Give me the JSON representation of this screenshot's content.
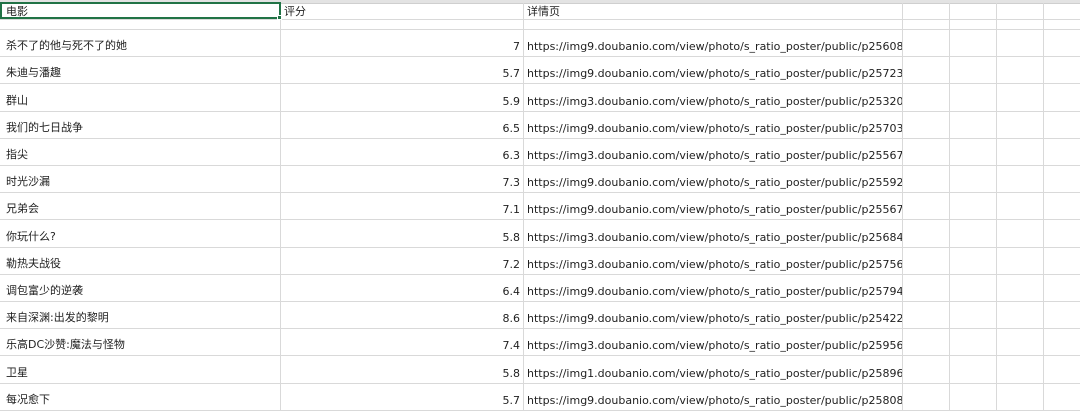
{
  "sheet": {
    "headers": [
      "电影",
      "评分",
      "详情页"
    ],
    "rows": [
      {
        "title": "杀不了的他与死不了的她",
        "rating": "7",
        "url": "https://img9.doubanio.com/view/photo/s_ratio_poster/public/p2560816964.jpg"
      },
      {
        "title": "朱迪与潘趣",
        "rating": "5.7",
        "url": "https://img9.doubanio.com/view/photo/s_ratio_poster/public/p2572380985.jpg"
      },
      {
        "title": "群山",
        "rating": "5.9",
        "url": "https://img3.doubanio.com/view/photo/s_ratio_poster/public/p2532051811.jpg"
      },
      {
        "title": "我们的七日战争",
        "rating": "6.5",
        "url": "https://img9.doubanio.com/view/photo/s_ratio_poster/public/p2570352974.jpg"
      },
      {
        "title": "指尖",
        "rating": "6.3",
        "url": "https://img3.doubanio.com/view/photo/s_ratio_poster/public/p2556768770.jpg"
      },
      {
        "title": "时光沙漏",
        "rating": "7.3",
        "url": "https://img9.doubanio.com/view/photo/s_ratio_poster/public/p2559242716.jpg"
      },
      {
        "title": "兄弟会",
        "rating": "7.1",
        "url": "https://img9.doubanio.com/view/photo/s_ratio_poster/public/p2556748824.jpg"
      },
      {
        "title": "你玩什么?",
        "rating": "5.8",
        "url": "https://img3.doubanio.com/view/photo/s_ratio_poster/public/p2568423110.jpg"
      },
      {
        "title": "勒热夫战役",
        "rating": "7.2",
        "url": "https://img3.doubanio.com/view/photo/s_ratio_poster/public/p2575688095.jpg"
      },
      {
        "title": "调包富少的逆袭",
        "rating": "6.4",
        "url": "https://img9.doubanio.com/view/photo/s_ratio_poster/public/p2579407695.jpg"
      },
      {
        "title": "来自深渊:出发的黎明",
        "rating": "8.6",
        "url": "https://img9.doubanio.com/view/photo/s_ratio_poster/public/p2542216236.jpg"
      },
      {
        "title": "乐高DC沙赞:魔法与怪物",
        "rating": "7.4",
        "url": "https://img3.doubanio.com/view/photo/s_ratio_poster/public/p2595667773.jpg"
      },
      {
        "title": "卫星",
        "rating": "5.8",
        "url": "https://img1.doubanio.com/view/photo/s_ratio_poster/public/p2589621187.jpg"
      },
      {
        "title": "每况愈下",
        "rating": "5.7",
        "url": "https://img9.doubanio.com/view/photo/s_ratio_poster/public/p2580862161.jpg"
      }
    ]
  }
}
